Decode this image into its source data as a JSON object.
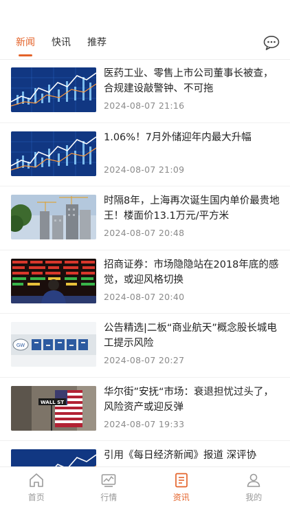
{
  "top_tabs": [
    "新闻",
    "快讯",
    "推荐"
  ],
  "active_tab": "新闻",
  "accent_color": "#e4632a",
  "news": [
    {
      "title": "医药工业、零售上市公司董事长被查，合规建设敲警钟、不可拖",
      "time": "2024-08-07 21:16",
      "image": "stock-chart"
    },
    {
      "title": "1.06%！7月外储迎年内最大升幅",
      "time": "2024-08-07 21:09",
      "image": "stock-chart"
    },
    {
      "title": "时隔8年，上海再次诞生国内单价最贵地王！楼面价13.1万元/平方米",
      "time": "2024-08-07 20:48",
      "image": "construction-site"
    },
    {
      "title": "招商证券：市场隐隐站在2018年底的感觉，或迎风格切换",
      "time": "2024-08-07 20:40",
      "image": "trading-screen"
    },
    {
      "title": "公告精选|二板“商业航天”概念股长城电工提示风险",
      "time": "2024-08-07 20:27",
      "image": "company-sign"
    },
    {
      "title": "华尔街”安抚“市场：衰退担忧过头了，风险资产或迎反弹",
      "time": "2024-08-07 19:33",
      "image": "wall-street"
    },
    {
      "title": "引用《每日经济新闻》报道 深评协",
      "time": "",
      "image": "stock-chart"
    }
  ],
  "bottom_nav": [
    {
      "label": "首页",
      "icon": "home-icon"
    },
    {
      "label": "行情",
      "icon": "market-chart-icon"
    },
    {
      "label": "资讯",
      "icon": "news-doc-icon"
    },
    {
      "label": "我的",
      "icon": "user-icon"
    }
  ],
  "active_nav": "资讯"
}
